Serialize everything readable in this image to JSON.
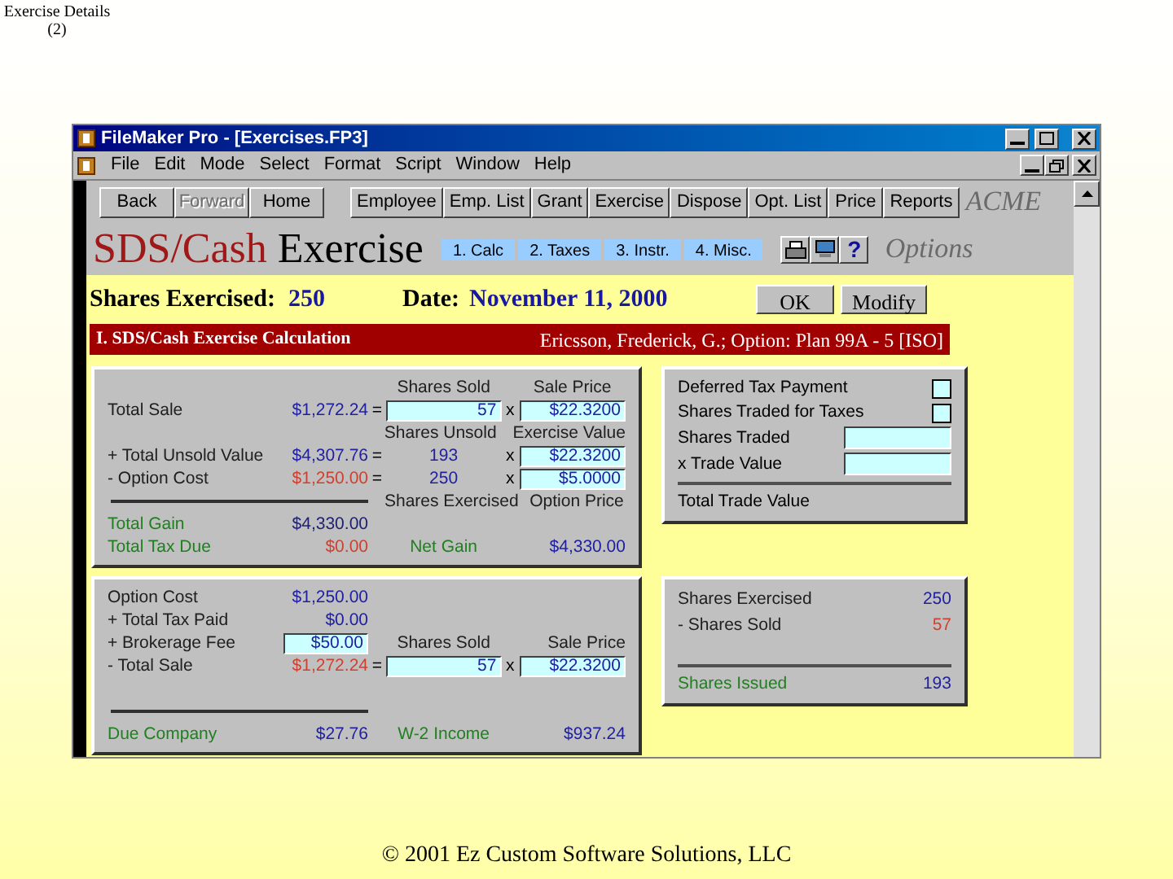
{
  "slide": {
    "title": "Exercise Details",
    "number": "(2)",
    "footer": "© 2001 Ez Custom Software Solutions, LLC"
  },
  "window": {
    "title": "FileMaker Pro - [Exercises.FP3]"
  },
  "menu": [
    "File",
    "Edit",
    "Mode",
    "Select",
    "Format",
    "Script",
    "Window",
    "Help"
  ],
  "nav_buttons": [
    {
      "label": "Back",
      "disabled": false
    },
    {
      "label": "Forward",
      "disabled": true
    },
    {
      "label": "Home",
      "disabled": false
    }
  ],
  "section_buttons": [
    "Employee",
    "Emp. List",
    "Grant",
    "Exercise",
    "Dispose",
    "Opt. List",
    "Price",
    "Reports"
  ],
  "brand": "ACME",
  "header": {
    "title_accent": "SDS/Cash",
    "title_rest": "Exercise",
    "options_label": "Options",
    "help_label": "?"
  },
  "tabs": [
    "1. Calc",
    "2. Taxes",
    "3. Instr.",
    "4. Misc."
  ],
  "summary": {
    "shares_label": "Shares Exercised:",
    "shares_value": "250",
    "date_label": "Date:",
    "date_value": "November 11, 2000"
  },
  "buttons": [
    "OK",
    "Modify"
  ],
  "section_bar": {
    "title": "I. SDS/Cash Exercise Calculation",
    "info": "Ericsson, Frederick, G.; Option: Plan 99A - 5 [ISO]"
  },
  "calc_panel": [
    {
      "kind": "heading",
      "mid": {
        "kind": "text",
        "text": "Shares Sold",
        "color": "#202020"
      },
      "right": {
        "kind": "text",
        "text": "Sale Price",
        "color": "#202020"
      }
    },
    {
      "kind": "line",
      "label": {
        "text": "Total Sale",
        "color": "#202020"
      },
      "amount": {
        "text": "$1,272.24",
        "color": "#2020a0"
      },
      "op": "=",
      "mid": {
        "kind": "field",
        "text": "57"
      },
      "times": "x",
      "right": {
        "kind": "field",
        "text": "$22.3200"
      }
    },
    {
      "kind": "heading",
      "mid": {
        "kind": "text",
        "text": "Shares Unsold",
        "color": "#202020"
      },
      "right": {
        "kind": "text",
        "text": "Exercise Value",
        "color": "#202020"
      }
    },
    {
      "kind": "line",
      "label": {
        "text": "+ Total Unsold Value",
        "color": "#202020"
      },
      "amount": {
        "text": "$4,307.76",
        "color": "#2020a0"
      },
      "op": "=",
      "mid": {
        "kind": "text",
        "text": "193",
        "color": "#2020a0"
      },
      "times": "x",
      "right": {
        "kind": "field",
        "text": "$22.3200"
      }
    },
    {
      "kind": "line",
      "label": {
        "text": "- Option Cost",
        "color": "#202020"
      },
      "amount": {
        "text": "$1,250.00",
        "color": "#d04030"
      },
      "op": "=",
      "mid": {
        "kind": "text",
        "text": "250",
        "color": "#2020a0"
      },
      "times": "x",
      "right": {
        "kind": "field",
        "text": "$5.0000"
      }
    },
    {
      "kind": "rule",
      "mid": {
        "kind": "text",
        "text": "Shares Exercised",
        "color": "#202020"
      },
      "right": {
        "kind": "text",
        "text": "Option Price",
        "color": "#202020"
      }
    },
    {
      "kind": "line",
      "label": {
        "text": "Total Gain",
        "color": "#208020"
      },
      "amount": {
        "text": "$4,330.00",
        "color": "#202070"
      }
    },
    {
      "kind": "line",
      "label": {
        "text": "Total Tax Due",
        "color": "#208020"
      },
      "amount": {
        "text": "$0.00",
        "color": "#d04030"
      },
      "mid": {
        "kind": "text",
        "text": "Net Gain",
        "color": "#208020"
      },
      "right": {
        "kind": "text",
        "text": "$4,330.00",
        "color": "#2020a0"
      }
    }
  ],
  "cost_panel": [
    {
      "kind": "line",
      "label": {
        "text": "Option Cost",
        "color": "#202020"
      },
      "amount": {
        "text": "$1,250.00",
        "color": "#2020a0"
      }
    },
    {
      "kind": "line",
      "label": {
        "text": "+ Total Tax Paid",
        "color": "#202020"
      },
      "amount": {
        "text": "$0.00",
        "color": "#2020a0"
      }
    },
    {
      "kind": "line",
      "label": {
        "text": "+ Brokerage Fee",
        "color": "#202020"
      },
      "amount": {
        "text": "$50.00",
        "color": "#2020a0",
        "field": true
      },
      "mid": {
        "kind": "text",
        "text": "Shares Sold",
        "color": "#202020"
      },
      "right": {
        "kind": "text",
        "text": "Sale Price",
        "color": "#202020"
      }
    },
    {
      "kind": "line",
      "label": {
        "text": "- Total Sale",
        "color": "#202020"
      },
      "amount": {
        "text": "$1,272.24",
        "color": "#d04030"
      },
      "op": "=",
      "mid": {
        "kind": "field",
        "text": "57"
      },
      "times": "x",
      "right": {
        "kind": "field",
        "text": "$22.3200"
      }
    },
    {
      "kind": "gap"
    },
    {
      "kind": "rule"
    },
    {
      "kind": "line",
      "label": {
        "text": "Due Company",
        "color": "#208020"
      },
      "amount": {
        "text": "$27.76",
        "color": "#2020a0"
      },
      "mid": {
        "kind": "text",
        "text": "W-2 Income",
        "color": "#208020"
      },
      "right": {
        "kind": "text",
        "text": "$937.24",
        "color": "#2020a0"
      }
    }
  ],
  "trade_panel": [
    {
      "kind": "checkbox",
      "label": "Deferred Tax Payment",
      "checked": false
    },
    {
      "kind": "checkbox",
      "label": "Shares Traded for Taxes",
      "checked": false
    },
    {
      "kind": "field",
      "label": "Shares Traded"
    },
    {
      "kind": "field",
      "label": "x Trade Value"
    },
    {
      "kind": "rule"
    },
    {
      "kind": "total",
      "label": "Total Trade Value"
    }
  ],
  "shares_panel": [
    {
      "kind": "line",
      "label": {
        "text": "Shares Exercised",
        "color": "#202020"
      },
      "value": {
        "text": "250",
        "color": "#2020a0"
      }
    },
    {
      "kind": "line",
      "label": {
        "text": "- Shares Sold",
        "color": "#202020"
      },
      "value": {
        "text": "57",
        "color": "#d04030"
      }
    },
    {
      "kind": "gap"
    },
    {
      "kind": "rule"
    },
    {
      "kind": "line",
      "label": {
        "text": "Shares Issued",
        "color": "#208020"
      },
      "value": {
        "text": "193",
        "color": "#2020a0"
      }
    }
  ]
}
